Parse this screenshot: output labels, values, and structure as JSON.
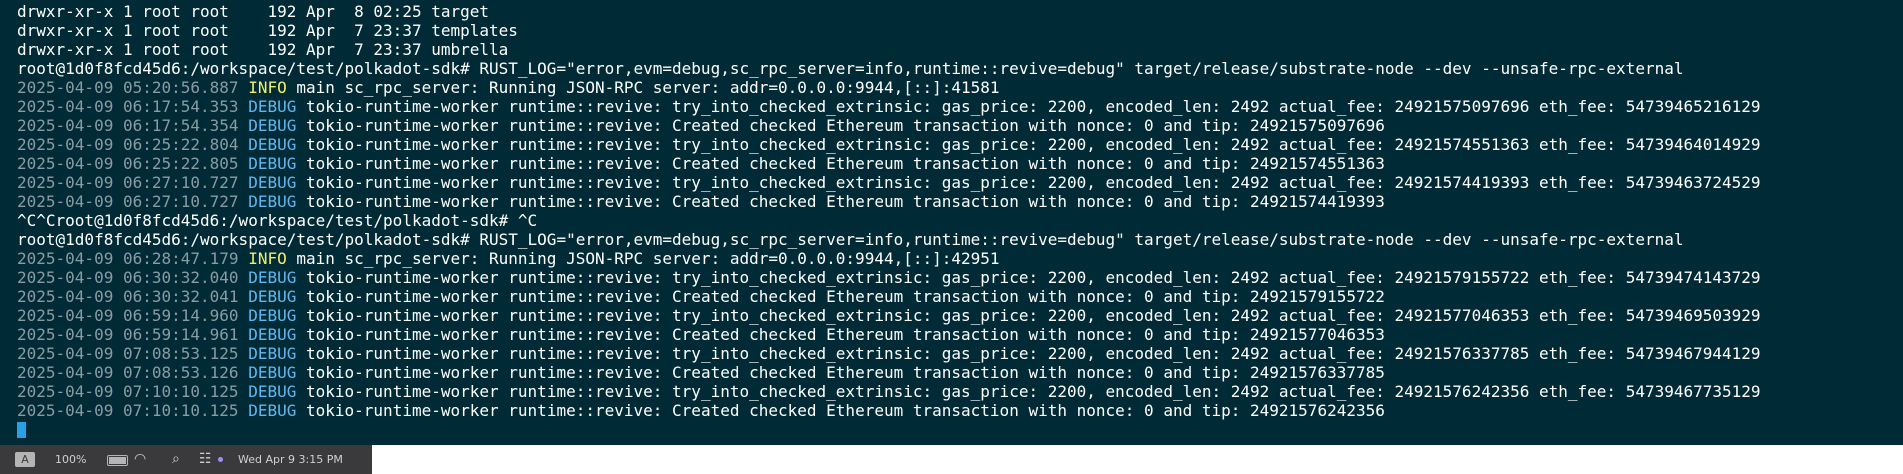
{
  "terminal": {
    "lines": [
      {
        "text": "drwxr-xr-x 1 root root    192 Apr  8 02:25 target"
      },
      {
        "text": "drwxr-xr-x 1 root root    192 Apr  7 23:37 templates"
      },
      {
        "text": "drwxr-xr-x 1 root root    192 Apr  7 23:37 umbrella"
      },
      {
        "text": "root@1d0f8fcd45d6:/workspace/test/polkadot-sdk# RUST_LOG=\"error,evm=debug,sc_rpc_server=info,runtime::revive=debug\" target/release/substrate-node --dev --unsafe-rpc-external"
      },
      {
        "ts": "2025-04-09 05:20:56.887 ",
        "level": "INFO",
        "msg": " main sc_rpc_server: Running JSON-RPC server: addr=0.0.0.0:9944,[::]:41581"
      },
      {
        "ts": "2025-04-09 06:17:54.353 ",
        "level": "DEBUG",
        "msg": " tokio-runtime-worker runtime::revive: try_into_checked_extrinsic: gas_price: 2200, encoded_len: 2492 actual_fee: 24921575097696 eth_fee: 54739465216129"
      },
      {
        "ts": "2025-04-09 06:17:54.354 ",
        "level": "DEBUG",
        "msg": " tokio-runtime-worker runtime::revive: Created checked Ethereum transaction with nonce: 0 and tip: 24921575097696"
      },
      {
        "ts": "2025-04-09 06:25:22.804 ",
        "level": "DEBUG",
        "msg": " tokio-runtime-worker runtime::revive: try_into_checked_extrinsic: gas_price: 2200, encoded_len: 2492 actual_fee: 24921574551363 eth_fee: 54739464014929"
      },
      {
        "ts": "2025-04-09 06:25:22.805 ",
        "level": "DEBUG",
        "msg": " tokio-runtime-worker runtime::revive: Created checked Ethereum transaction with nonce: 0 and tip: 24921574551363"
      },
      {
        "ts": "2025-04-09 06:27:10.727 ",
        "level": "DEBUG",
        "msg": " tokio-runtime-worker runtime::revive: try_into_checked_extrinsic: gas_price: 2200, encoded_len: 2492 actual_fee: 24921574419393 eth_fee: 54739463724529"
      },
      {
        "ts": "2025-04-09 06:27:10.727 ",
        "level": "DEBUG",
        "msg": " tokio-runtime-worker runtime::revive: Created checked Ethereum transaction with nonce: 0 and tip: 24921574419393"
      },
      {
        "text": "^C^Croot@1d0f8fcd45d6:/workspace/test/polkadot-sdk# ^C"
      },
      {
        "text": "root@1d0f8fcd45d6:/workspace/test/polkadot-sdk# RUST_LOG=\"error,evm=debug,sc_rpc_server=info,runtime::revive=debug\" target/release/substrate-node --dev --unsafe-rpc-external"
      },
      {
        "ts": "2025-04-09 06:28:47.179 ",
        "level": "INFO",
        "msg": " main sc_rpc_server: Running JSON-RPC server: addr=0.0.0.0:9944,[::]:42951"
      },
      {
        "ts": "2025-04-09 06:30:32.040 ",
        "level": "DEBUG",
        "msg": " tokio-runtime-worker runtime::revive: try_into_checked_extrinsic: gas_price: 2200, encoded_len: 2492 actual_fee: 24921579155722 eth_fee: 54739474143729"
      },
      {
        "ts": "2025-04-09 06:30:32.041 ",
        "level": "DEBUG",
        "msg": " tokio-runtime-worker runtime::revive: Created checked Ethereum transaction with nonce: 0 and tip: 24921579155722"
      },
      {
        "ts": "2025-04-09 06:59:14.960 ",
        "level": "DEBUG",
        "msg": " tokio-runtime-worker runtime::revive: try_into_checked_extrinsic: gas_price: 2200, encoded_len: 2492 actual_fee: 24921577046353 eth_fee: 54739469503929"
      },
      {
        "ts": "2025-04-09 06:59:14.961 ",
        "level": "DEBUG",
        "msg": " tokio-runtime-worker runtime::revive: Created checked Ethereum transaction with nonce: 0 and tip: 24921577046353"
      },
      {
        "ts": "2025-04-09 07:08:53.125 ",
        "level": "DEBUG",
        "msg": " tokio-runtime-worker runtime::revive: try_into_checked_extrinsic: gas_price: 2200, encoded_len: 2492 actual_fee: 24921576337785 eth_fee: 54739467944129"
      },
      {
        "ts": "2025-04-09 07:08:53.126 ",
        "level": "DEBUG",
        "msg": " tokio-runtime-worker runtime::revive: Created checked Ethereum transaction with nonce: 0 and tip: 24921576337785"
      },
      {
        "ts": "2025-04-09 07:10:10.125 ",
        "level": "DEBUG",
        "msg": " tokio-runtime-worker runtime::revive: try_into_checked_extrinsic: gas_price: 2200, encoded_len: 2492 actual_fee: 24921576242356 eth_fee: 54739467735129"
      },
      {
        "ts": "2025-04-09 07:10:10.125 ",
        "level": "DEBUG",
        "msg": " tokio-runtime-worker runtime::revive: Created checked Ethereum transaction with nonce: 0 and tip: 24921576242356"
      }
    ]
  },
  "colors": {
    "background": "#002b36",
    "info": "#eef06a",
    "debug": "#5fb8f0",
    "cursor": "#2aa1e6"
  },
  "taskbar": {
    "input_source": "A",
    "battery": "100%",
    "datetime": "Wed Apr 9  3:15 PM",
    "icons": [
      "input-source-icon",
      "battery-icon",
      "wifi-icon",
      "search-icon",
      "control-center-icon",
      "siri-icon"
    ]
  }
}
